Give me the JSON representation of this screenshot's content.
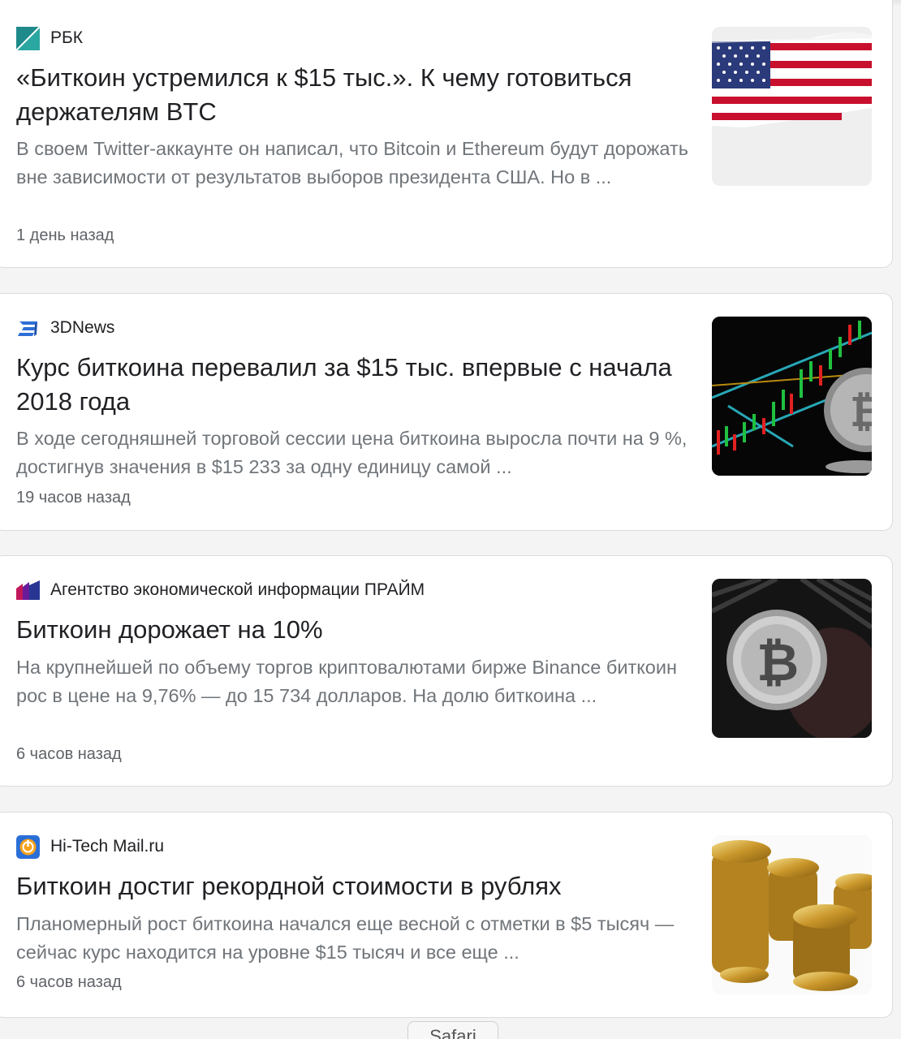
{
  "articles": [
    {
      "source": "РБК",
      "title": "«Биткоин устремился к $15 тыс.». К чему готовиться держателям BTC",
      "snippet": "В своем Twitter-аккаунте он написал, что Bitcoin и Ethereum будут дорожать вне зависимости от результатов выборов президента США. Но в ...",
      "time": "1 день назад",
      "image": "us-flag-image"
    },
    {
      "source": "3DNews",
      "title": "Курс биткоина перевалил за $15 тыс. впервые с начала 2018 года",
      "snippet": "В ходе сегодняшней торговой сессии цена биткоина выросла почти на 9 %, достигнув значения в $15 233 за одну единицу самой ...",
      "time": "19 часов назад",
      "image": "bitcoin-chart-image"
    },
    {
      "source": "Агентство экономической информации ПРАЙМ",
      "title": "Биткоин дорожает на 10%",
      "snippet": "На крупнейшей по объему торгов криптовалютами бирже Binance биткоин рос в цене на 9,76% — до 15 734 долларов. На долю биткоина ...",
      "time": "6 часов назад",
      "image": "bitcoin-coin-image"
    },
    {
      "source": "Hi-Tech Mail.ru",
      "title": "Биткоин достиг рекордной стоимости в рублях",
      "snippet": "Планомерный рост биткоина начался еще весной с отметки в $5 тысяч — сейчас курс находится на уровне $15 тысяч и все еще ...",
      "time": "6 часов назад",
      "image": "gold-coins-image"
    }
  ],
  "browser_tab": {
    "label": "Safari"
  },
  "colors": {
    "title": "#202124",
    "snippet": "#70757a",
    "time": "#5f6368",
    "card_border": "#dadce0"
  }
}
